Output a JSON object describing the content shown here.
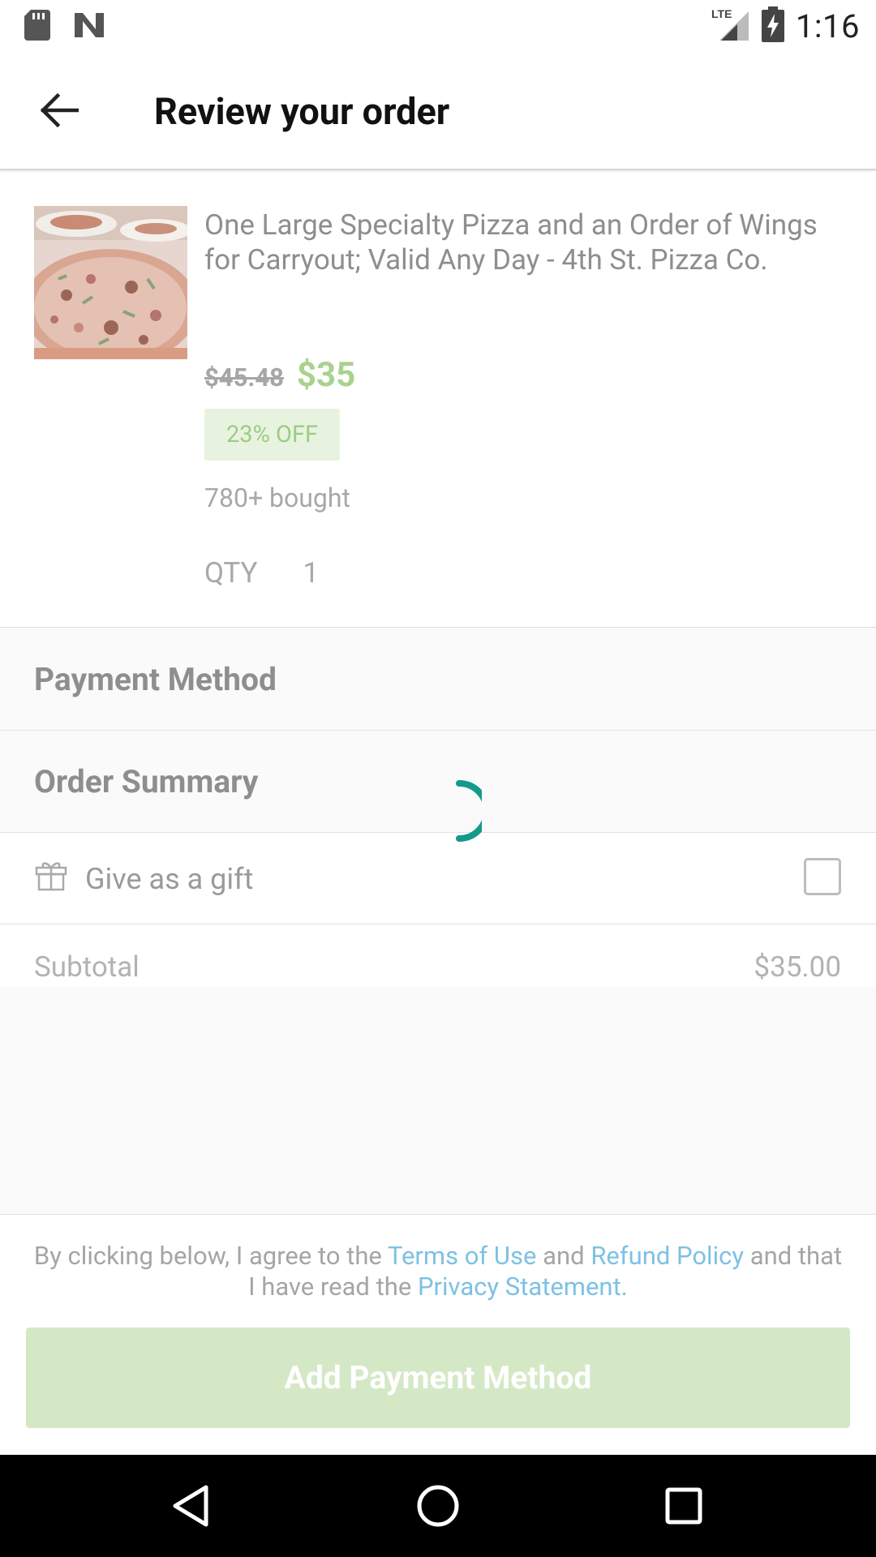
{
  "status_bar": {
    "time": "1:16",
    "network": "LTE",
    "icons": [
      "sd-card-icon",
      "n-logo-icon",
      "lte-signal-icon",
      "battery-charging-icon"
    ]
  },
  "app_bar": {
    "title": "Review your order",
    "back_icon": "arrow-back-icon"
  },
  "product": {
    "title": "One Large Specialty Pizza and an Order of Wings for Carryout; Valid Any Day - 4th St. Pizza Co.",
    "old_price": "$45.48",
    "new_price": "$35",
    "discount": "23% OFF",
    "bought": "780+ bought",
    "qty_label": "QTY",
    "qty_value": "1"
  },
  "sections": {
    "payment_method": "Payment Method",
    "order_summary": "Order Summary"
  },
  "gift": {
    "label": "Give as a gift",
    "checked": false
  },
  "subtotal": {
    "label": "Subtotal",
    "value": "$35.00"
  },
  "terms": {
    "prefix": "By clicking below, I agree to the ",
    "terms_link": "Terms of Use",
    "and1": " and ",
    "refund_link": "Refund Policy",
    "and2": " and that I have read the ",
    "privacy_link": "Privacy Statement",
    "suffix": "."
  },
  "cta": {
    "label": "Add Payment Method"
  },
  "colors": {
    "accent_green": "#a8d28e",
    "link_blue": "#7dc1e3",
    "spinner_teal": "#139a8a",
    "cta_bg": "#d5e8c6"
  }
}
